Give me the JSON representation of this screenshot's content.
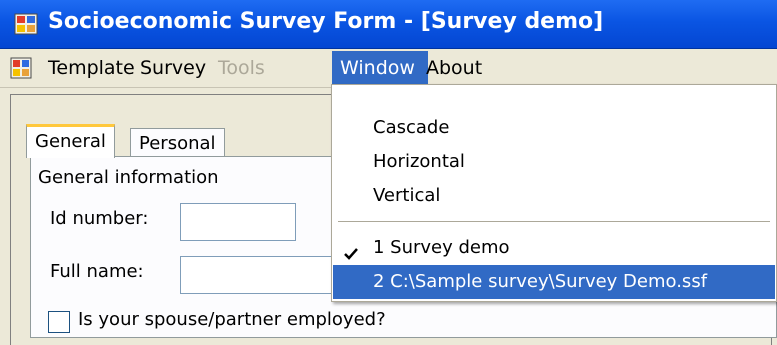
{
  "window": {
    "title": "Socioeconomic Survey Form - [Survey demo]"
  },
  "menubar": {
    "items": [
      {
        "label": "Template",
        "disabled": false,
        "active": false
      },
      {
        "label": "Survey",
        "disabled": false,
        "active": false
      },
      {
        "label": "Tools",
        "disabled": true,
        "active": false
      },
      {
        "label": "Window",
        "disabled": false,
        "active": true
      },
      {
        "label": "About",
        "disabled": false,
        "active": false
      }
    ]
  },
  "window_menu": {
    "items": [
      {
        "label": "Cascade"
      },
      {
        "label": "Horizontal"
      },
      {
        "label": "Vertical"
      },
      {
        "label": "1 Survey demo",
        "checked": true
      },
      {
        "label": "2 C:\\Sample survey\\Survey Demo.ssf",
        "highlighted": true
      }
    ]
  },
  "form": {
    "tabs": [
      {
        "label": "General",
        "selected": true
      },
      {
        "label": "Personal",
        "selected": false
      }
    ],
    "group_label": "General information",
    "fields": {
      "id_number_label": "Id number:",
      "full_name_label": "Full name:",
      "id_number_value": "",
      "full_name_value": ""
    },
    "spouse_checkbox_label": "Is your spouse/partner employed?",
    "spouse_checkbox_checked": false
  },
  "colors": {
    "titlebar": "#0a55e3",
    "menu_highlight": "#316ac5",
    "tab_accent": "#ffc83c",
    "face": "#ece9d8"
  }
}
